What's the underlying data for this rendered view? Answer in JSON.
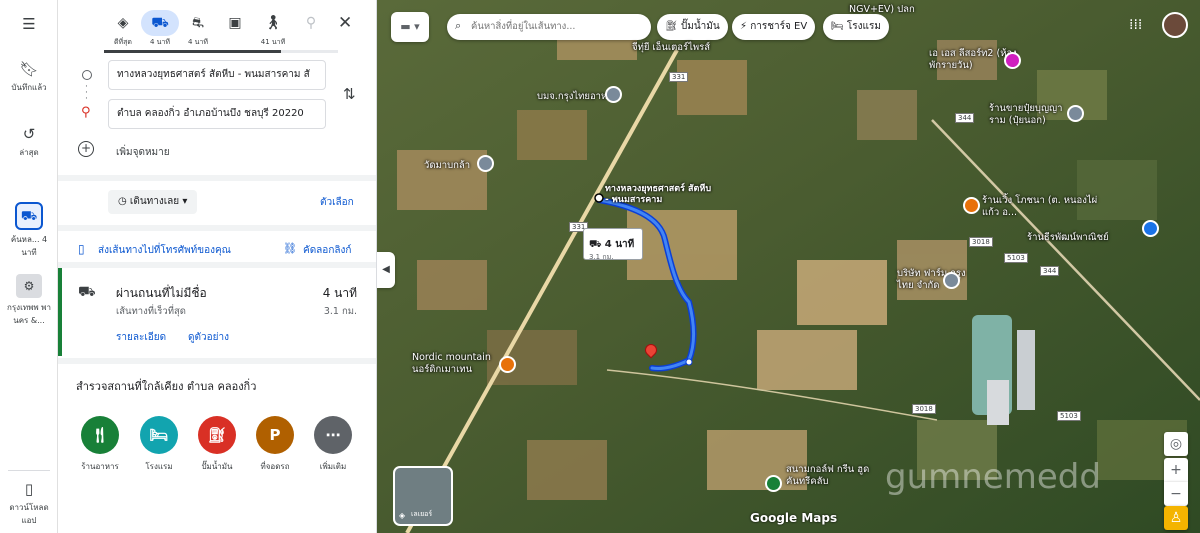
{
  "rail": {
    "saved": "บันทึกแล้ว",
    "recent": "ล่าสุด",
    "route_item": "ค้นหล... 4 นาที",
    "place_item": "กรุงเทพพ พานคร &...",
    "app": "ดาวน์โหลด แอป"
  },
  "modes": [
    {
      "icon": "best-route-icon",
      "label": "ดีที่สุด"
    },
    {
      "icon": "car-icon",
      "label": "4 นาที"
    },
    {
      "icon": "motorcycle-icon",
      "label": "4 นาที"
    },
    {
      "icon": "transit-icon",
      "label": ""
    },
    {
      "icon": "walk-icon",
      "label": "41 นาที"
    },
    {
      "icon": "bike-icon",
      "label": ""
    }
  ],
  "origin": "ทางหลวงยุทธศาสตร์ สัตหีบ - พนมสารคาม สั",
  "destination": "ตำบล คลองกิ่ว อำเภอบ้านบึง ชลบุรี 20220",
  "add_stop": "เพิ่มจุดหมาย",
  "depart": "เดินทางเลย",
  "options": "ตัวเลือก",
  "send_to_phone": "ส่งเส้นทางไปที่โทรศัพท์ของคุณ",
  "copy_link": "คัดลอกลิงก์",
  "route": {
    "name": "ผ่านถนนที่ไม่มีชื่อ",
    "time": "4 นาที",
    "subtitle": "เส้นทางที่เร็วที่สุด",
    "distance": "3.1 กม.",
    "details": "รายละเอียด",
    "preview": "ดูตัวอย่าง"
  },
  "explore": {
    "title": "สำรวจสถานที่ใกล้เคียง ตำบล คลองกิ่ว",
    "categories": [
      {
        "label": "ร้านอาหาร",
        "icon": "restaurant-icon",
        "color": "#188038"
      },
      {
        "label": "โรงแรม",
        "icon": "hotel-icon",
        "color": "#12a4af"
      },
      {
        "label": "ปั๊มน้ำมัน",
        "icon": "gas-station-icon",
        "color": "#d93025"
      },
      {
        "label": "ที่จอดรถ",
        "icon": "parking-icon",
        "color": "#b06000"
      },
      {
        "label": "เพิ่มเติม",
        "icon": "more-icon",
        "color": "#5f6368"
      }
    ]
  },
  "map": {
    "search_placeholder": "ค้นหาสิ่งที่อยู่ในเส้นทาง...",
    "chips": [
      "ปั๊มน้ำมัน",
      "การชาร์จ EV",
      "โรงแรม"
    ],
    "route_time": "4 นาที",
    "route_dist": "3.1 กม.",
    "origin_label": "ทางหลวงยุทธศาสตร์ สัตหีบ - พนมสารคาม",
    "labels": [
      "NGV+EV) ปลก",
      "เอ เอส ลีสอร์ท2 (ห้องพักรายวัน)",
      "ร้านขายปุ๋ยบุญญาราม (ปุ๋ยนอก)",
      "บมจ.กรุงไทยอาหาร",
      "วัดมาบกล้า",
      "ร้านเวิ้ง โภชนา (ต. หนองไผ่แก้ว อ...",
      "ร้านธีรพัฒน์พาณิชย์",
      "บริษัท ฟาร์ม กรุงไทย จำกัด",
      "Nordic mountain นอร์ดิกเมาเทน",
      "สนามกอล์ฟ กรีน ฮูด คันทรีคลับ",
      "จีทุ่ยี เอ็นเตอร์ไพรส์"
    ],
    "roads": [
      "331",
      "344",
      "3018",
      "3018",
      "5103",
      "5103",
      "344",
      "331"
    ],
    "layers": "เลเยอร์",
    "attribution": "Google Maps",
    "watermark": "gumnemedd"
  }
}
